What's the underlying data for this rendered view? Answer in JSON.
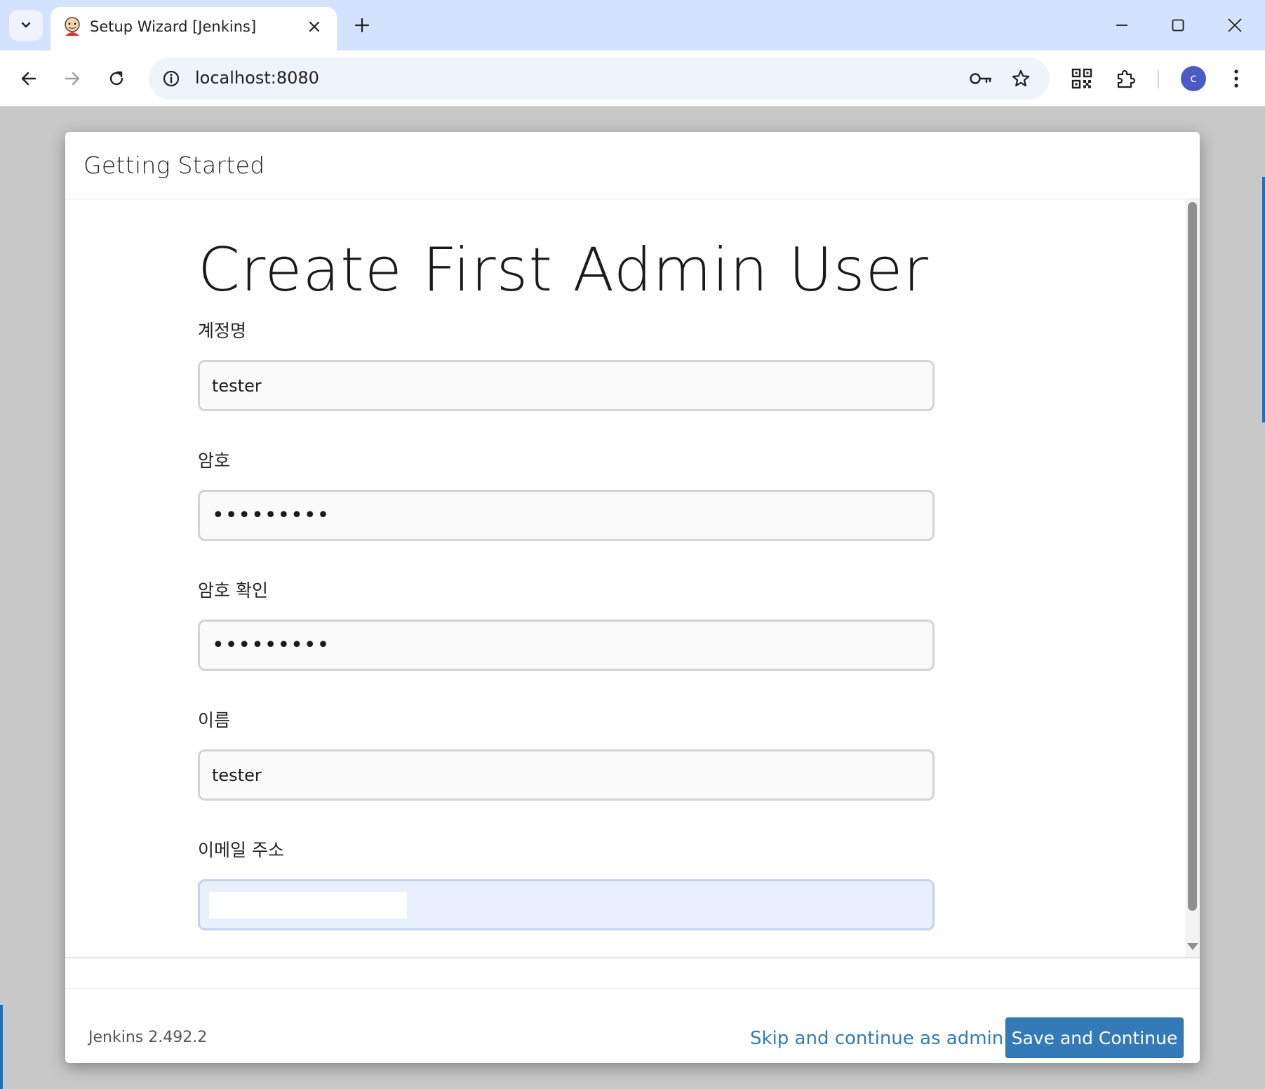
{
  "browser": {
    "tab_title": "Setup Wizard [Jenkins]",
    "url": "localhost:8080",
    "profile_initial": "c"
  },
  "modal": {
    "header_title": "Getting Started",
    "heading": "Create First Admin User",
    "fields": [
      {
        "label": "계정명",
        "value": "tester",
        "type": "text"
      },
      {
        "label": "암호",
        "value": "•••••••••",
        "type": "password"
      },
      {
        "label": "암호 확인",
        "value": "•••••••••",
        "type": "password"
      },
      {
        "label": "이름",
        "value": "tester",
        "type": "text"
      },
      {
        "label": "이메일 주소",
        "value": "",
        "type": "email"
      }
    ],
    "footer": {
      "version": "Jenkins 2.492.2",
      "skip_label": "Skip and continue as admin",
      "save_label": "Save and Continue"
    }
  },
  "colors": {
    "tabstrip": "#d3e3fd",
    "primary_button": "#337ab7",
    "link": "#337ab7",
    "page_overlay": "#c8c8c8"
  }
}
